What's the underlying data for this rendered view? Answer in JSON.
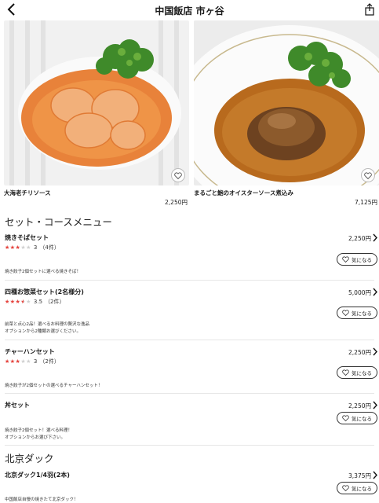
{
  "header": {
    "title": "中国飯店 市ヶ谷"
  },
  "featured": [
    {
      "name": "大海老チリソース",
      "price": "2,250円"
    },
    {
      "name": "まるごと鮑のオイスターソース煮込み",
      "price": "7,125円"
    }
  ],
  "sections": [
    {
      "title": "セット・コースメニュー"
    },
    {
      "title": "北京ダック"
    }
  ],
  "items": [
    {
      "name": "焼きそばセット",
      "price": "2,250円",
      "rating": 3,
      "rating_text": "3",
      "reviews": "（4件）",
      "desc_lines": [
        "焼き餃子2個セットに選べる焼きそば！"
      ],
      "like_label": "気になる"
    },
    {
      "name": "四種お惣菜セット(2名様分)",
      "price": "5,000円",
      "rating": 3.5,
      "rating_text": "3.5",
      "reviews": "（2件）",
      "desc_lines": [
        "前菜と点心2品！選べるお料理の贅沢な逸品",
        "オプションから2種類お選びください。"
      ],
      "like_label": "気になる"
    },
    {
      "name": "チャーハンセット",
      "price": "2,250円",
      "rating": 3,
      "rating_text": "3",
      "reviews": "（2件）",
      "desc_lines": [
        "焼き餃子が2個セットの選べるチャーハンセット！"
      ],
      "like_label": "気になる"
    },
    {
      "name": "丼セット",
      "price": "2,250円",
      "desc_lines": [
        "焼き餃子2個セット！選べる料理！",
        "オプションからお選び下さい。"
      ],
      "like_label": "気になる"
    },
    {
      "name": "北京ダック1/4羽(2本)",
      "price": "3,375円",
      "desc_lines": [
        "中国飯店自慢の焼きたて北京ダック！"
      ],
      "like_label": "気になる"
    }
  ],
  "colors": {
    "star": "#e8423c",
    "star_empty": "#d0d0d0",
    "sauce": "#e8823a",
    "broccoli": "#3f8a2a"
  }
}
